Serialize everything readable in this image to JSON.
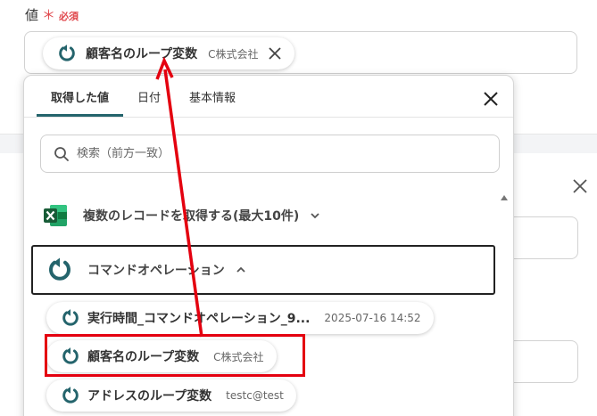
{
  "field": {
    "label": "値",
    "required_mark": "＊",
    "required_text": "必須"
  },
  "selected_chip": {
    "name": "顧客名のループ変数",
    "value": "C株式会社"
  },
  "dropdown": {
    "tabs": [
      {
        "label": "取得した値",
        "active": true
      },
      {
        "label": "日付",
        "active": false
      },
      {
        "label": "基本情報",
        "active": false
      }
    ],
    "search_placeholder": "検索（前方一致）",
    "groups": [
      {
        "label": "複数のレコードを取得する(最大10件)",
        "icon": "excel-icon",
        "expanded": false
      },
      {
        "label": "コマンドオペレーション",
        "icon": "loop-icon",
        "expanded": true
      }
    ],
    "items": [
      {
        "name": "実行時間_コマンドオペレーション_9...",
        "value": "2025-07-16 14:52"
      },
      {
        "name": "顧客名のループ変数",
        "value": "C株式会社"
      },
      {
        "name": "アドレスのループ変数",
        "value": "testc@test"
      }
    ]
  },
  "colors": {
    "accent": "#24646c",
    "required": "#e0474c",
    "highlight": "#e4000f",
    "excel_green": "#1d6f42"
  }
}
